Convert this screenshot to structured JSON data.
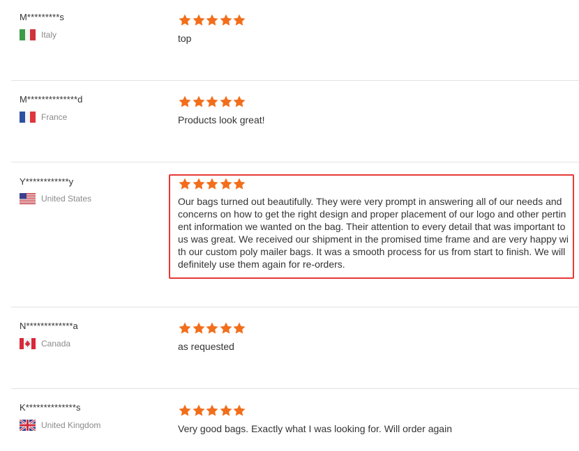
{
  "colors": {
    "star": "#f26e1b",
    "highlight_border": "#e53935",
    "divider": "#e2e2e2"
  },
  "reviews": [
    {
      "buyer": "M*********s",
      "country": "Italy",
      "flag_icon": "italy-flag-icon",
      "rating": 5,
      "text": "top"
    },
    {
      "buyer": "M**************d",
      "country": "France",
      "flag_icon": "france-flag-icon",
      "rating": 5,
      "text": "Products look great!"
    },
    {
      "buyer": "Y************y",
      "country": "United States",
      "flag_icon": "usa-flag-icon",
      "rating": 5,
      "text": "Our bags turned out beautifully. They were very prompt in answering all of our needs and concerns on how to get the right design and proper placement of our logo and other pertinent information we wanted on the bag. Their attention to every detail that was important to us was great. We received our shipment in the promised time frame and are very happy with our custom poly mailer bags. It was a smooth process for us from start to finish. We will definitely use them again for re-orders.",
      "highlighted": true
    },
    {
      "buyer": "N*************a",
      "country": "Canada",
      "flag_icon": "canada-flag-icon",
      "rating": 5,
      "text": "as requested"
    },
    {
      "buyer": "K**************s",
      "country": "United Kingdom",
      "flag_icon": "uk-flag-icon",
      "rating": 5,
      "text": "Very good bags. Exactly what I was looking for. Will order again"
    }
  ]
}
